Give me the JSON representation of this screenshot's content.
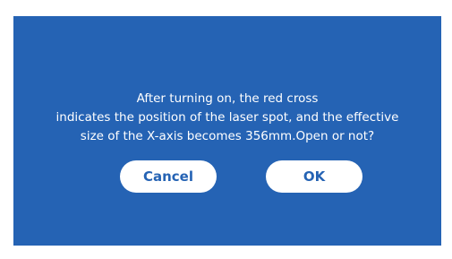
{
  "dialog": {
    "message_lines": [
      "After turning on, the red cross",
      "indicates the position of the laser spot, and the effective",
      "size of the X-axis becomes 356mm.Open or not?"
    ],
    "cancel_label": "Cancel",
    "ok_label": "OK"
  },
  "colors": {
    "background": "#2563b4",
    "button_background": "#ffffff",
    "button_text": "#2563b4",
    "message_text": "#ffffff"
  }
}
